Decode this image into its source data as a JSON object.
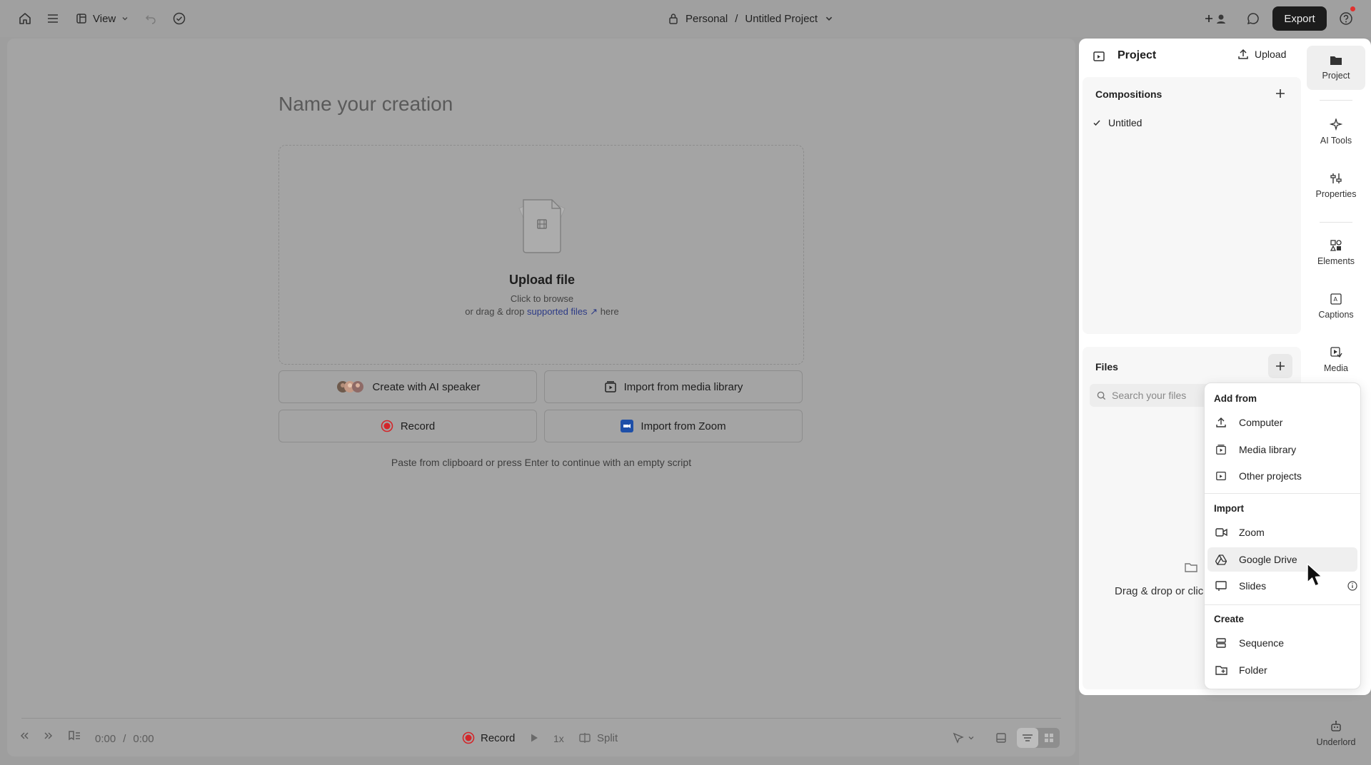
{
  "topbar": {
    "view_label": "View",
    "breadcrumb_workspace": "Personal",
    "breadcrumb_separator": "/",
    "breadcrumb_project": "Untitled Project",
    "export_label": "Export"
  },
  "editor": {
    "title_placeholder": "Name your creation",
    "upload_title": "Upload file",
    "upload_click": "Click to browse",
    "upload_drag_prefix": "or drag & drop",
    "upload_link": "supported files ↗",
    "upload_drag_suffix": "here",
    "btn_ai_speaker": "Create with AI speaker",
    "btn_media_library": "Import from media library",
    "btn_record": "Record",
    "btn_zoom": "Import from Zoom",
    "paste_hint": "Paste from clipboard or press Enter to continue with an empty script"
  },
  "bottombar": {
    "time_current": "0:00",
    "time_sep": "/",
    "time_total": "0:00",
    "record_label": "Record",
    "speed": "1x",
    "split_label": "Split"
  },
  "panel": {
    "title": "Project",
    "upload_label": "Upload",
    "compositions_heading": "Compositions",
    "composition_item": "Untitled",
    "files_heading": "Files",
    "search_placeholder": "Search your files",
    "files_empty_hint": "Drag & drop or clic"
  },
  "rail": [
    {
      "label": "Project",
      "icon": "folder-icon"
    },
    {
      "label": "AI Tools",
      "icon": "sparkle-icon"
    },
    {
      "label": "Properties",
      "icon": "sliders-icon"
    },
    {
      "label": "Elements",
      "icon": "shapes-icon"
    },
    {
      "label": "Captions",
      "icon": "captions-icon"
    },
    {
      "label": "Media",
      "icon": "media-icon"
    },
    {
      "label": "Underlord",
      "icon": "robot-icon"
    }
  ],
  "dropdown": {
    "add_from_heading": "Add from",
    "computer": "Computer",
    "media_library": "Media library",
    "other_projects": "Other projects",
    "import_heading": "Import",
    "zoom": "Zoom",
    "google_drive": "Google Drive",
    "slides": "Slides",
    "create_heading": "Create",
    "sequence": "Sequence",
    "folder": "Folder"
  },
  "colors": {
    "accent_dark": "#1c1c1c",
    "record_red": "#d3262a",
    "link_blue": "#2c3a86",
    "notification_red": "#e0312f"
  }
}
